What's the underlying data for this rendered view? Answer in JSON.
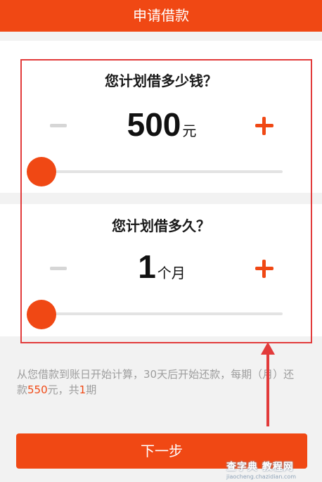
{
  "header": {
    "title": "申请借款"
  },
  "amount": {
    "question": "您计划借多少钱？",
    "value": "500",
    "unit": "元",
    "slider_fraction": 0
  },
  "term": {
    "question": "您计划借多久？",
    "value": "1",
    "unit": "个月",
    "slider_fraction": 0
  },
  "info": {
    "prefix": "从您借款到账日开始计算，30天后开始还款，每期（月）还款",
    "repay_amount": "550",
    "repay_unit": "元，共",
    "periods": "1",
    "periods_unit": "期"
  },
  "next_button": {
    "label": "下一步"
  },
  "watermark": {
    "line1": "查字典 教程网",
    "line2": "jiaocheng.chazidian.com"
  },
  "colors": {
    "accent": "#f04814",
    "annotation": "#e23b3b"
  }
}
